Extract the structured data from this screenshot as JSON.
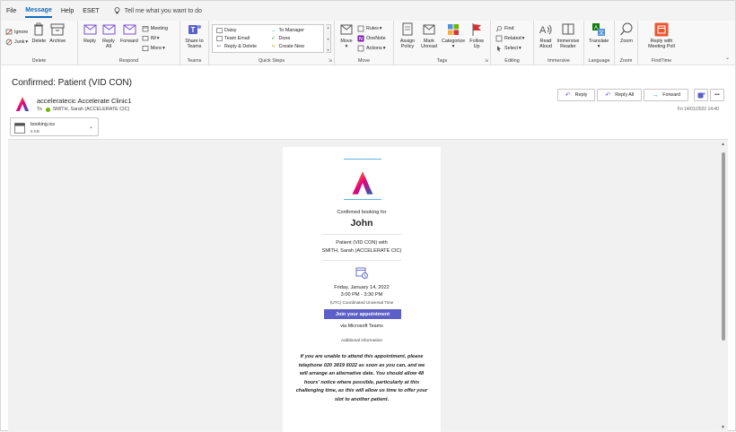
{
  "menu": {
    "tabs": [
      "File",
      "Message",
      "Help",
      "ESET"
    ],
    "active_tab": "Message",
    "tell_me": "Tell me what you want to do"
  },
  "ribbon": {
    "delete": {
      "label": "Delete",
      "ignore": "Ignore",
      "junk": "Junk",
      "delete_btn": "Delete",
      "archive": "Archive"
    },
    "respond": {
      "label": "Respond",
      "reply": "Reply",
      "reply_all": "Reply All",
      "forward": "Forward",
      "meeting": "Meeting",
      "im": "IM",
      "more": "More"
    },
    "teams": {
      "label": "Teams",
      "share": "Share to Teams"
    },
    "quick_steps": {
      "label": "Quick Steps",
      "items": [
        "Daisy",
        "To Manager",
        "Team Email",
        "Done",
        "Reply & Delete",
        "Create New"
      ]
    },
    "move": {
      "label": "Move",
      "move_btn": "Move",
      "rules": "Rules",
      "onenote": "OneNote",
      "actions": "Actions"
    },
    "tags": {
      "label": "Tags",
      "assign_policy": "Assign Policy",
      "mark_unread": "Mark Unread",
      "categorize": "Categorize",
      "follow_up": "Follow Up"
    },
    "editing": {
      "label": "Editing",
      "find": "Find",
      "related": "Related",
      "select": "Select"
    },
    "immersive": {
      "label": "Immersive",
      "read_aloud": "Read Aloud",
      "immersive_reader": "Immersive Reader"
    },
    "language": {
      "label": "Language",
      "translate": "Translate"
    },
    "zoom": {
      "label": "Zoom",
      "zoom_btn": "Zoom"
    },
    "findtime": {
      "label": "FindTime",
      "reply_meeting_poll": "Reply with Meeting Poll"
    }
  },
  "message": {
    "subject": "Confirmed: Patient (VID CON)",
    "sender": "acceleratecic Accelerate Clinic1",
    "to_prefix": "To",
    "to": "SMITH, Sarah (ACCELERATE CIC)",
    "date": "Fri 14/01/2022 14:40",
    "actions": {
      "reply": "Reply",
      "reply_all": "Reply All",
      "forward": "Forward",
      "more": "•••"
    },
    "attachment": {
      "name": "booking.ics",
      "size": "5 KB"
    }
  },
  "card": {
    "confirmed": "Confirmed booking for",
    "name": "John",
    "service_line1": "Patient (VID CON) with",
    "service_line2": "SMITH, Sarah (ACCELERATE CIC)",
    "date": "Friday, January 14, 2022",
    "time": "3:00 PM - 3:30 PM",
    "timezone": "(UTC) Coordinated Universal Time",
    "join": "Join your appointment",
    "via": "via Microsoft Teams",
    "additional": "Additional information",
    "notice": "If you are unable to attend this appointment, please telephone 020 3819 6022 as soon as you can, and we will arrange an alternative date.  You should allow 48 hours' notice where possible, particularly at this challenging time, as this will allow us time to offer your slot to another patient."
  },
  "colors": {
    "accent": "#0f6cbd",
    "teams_purple": "#5b5fc7",
    "presence": "#6bb700",
    "findtime": "#e8552f"
  }
}
